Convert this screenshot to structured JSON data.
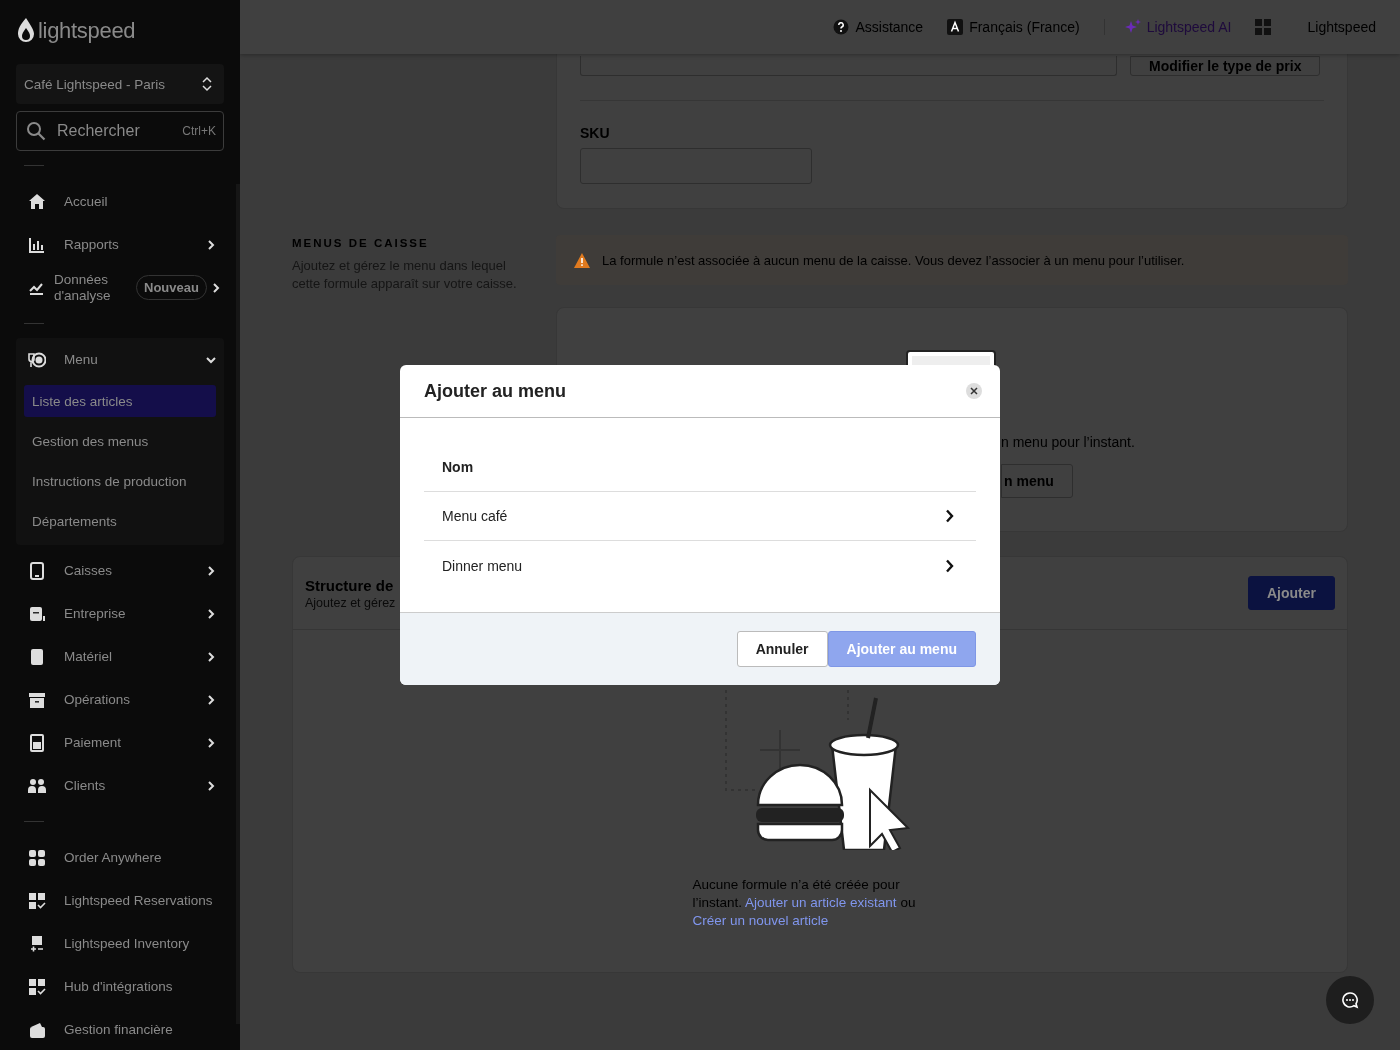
{
  "header": {
    "links": [
      {
        "kind": "help",
        "label": "Assistance"
      },
      {
        "kind": "language",
        "label": "Français (France)"
      },
      {
        "kind": "ai",
        "label": "Lightspeed AI"
      },
      {
        "kind": "apps"
      },
      {
        "kind": "account",
        "label": "Lightspeed"
      }
    ]
  },
  "sidebar": {
    "logo": "lightspeed",
    "store": "Café Lightspeed - Paris",
    "search": {
      "placeholder": "Rechercher",
      "shortcut": "Ctrl+K"
    },
    "groups": [
      {
        "items": [
          {
            "kind": "home",
            "label": "Accueil"
          },
          {
            "kind": "chart",
            "label": "Rapports",
            "expanded": false
          },
          {
            "kind": "trend",
            "label": "Données d'analyse",
            "badge": "Nouveau",
            "expanded": false
          }
        ]
      },
      {
        "items": [
          {
            "kind": "plate",
            "label": "Menu",
            "expanded": true,
            "children": [
              {
                "label": "Liste des articles",
                "selected": true
              },
              {
                "label": "Gestion des menus",
                "selected": false
              },
              {
                "label": "Instructions de production",
                "selected": false
              },
              {
                "label": "Départements",
                "selected": false
              }
            ]
          },
          {
            "kind": "tablet",
            "label": "Caisses",
            "expanded": false
          },
          {
            "kind": "business",
            "label": "Entreprise",
            "expanded": false
          },
          {
            "kind": "device",
            "label": "Matériel",
            "expanded": false
          },
          {
            "kind": "archive",
            "label": "Opérations",
            "expanded": false
          },
          {
            "kind": "calculator",
            "label": "Paiement",
            "expanded": false
          },
          {
            "kind": "people",
            "label": "Clients",
            "expanded": false
          }
        ]
      },
      {
        "items": [
          {
            "kind": "grid",
            "label": "Order Anywhere"
          },
          {
            "kind": "gridcheck",
            "label": "Lightspeed Reservations"
          },
          {
            "kind": "inventory",
            "label": "Lightspeed Inventory"
          },
          {
            "kind": "gridcheck",
            "label": "Hub d'intégrations"
          },
          {
            "kind": "wallet",
            "label": "Gestion financière"
          }
        ]
      }
    ]
  },
  "price_row": {
    "button": "Modifier le type de prix"
  },
  "sku": {
    "label": "SKU"
  },
  "pos_menus": {
    "title": "MENUS DE CAISSE",
    "description": "Ajoutez et gérez le menu dans lequel cette formule apparaît sur votre caisse.",
    "warning": "La formule n’est associée à aucun menu de la caisse. Vous devez l’associer à un menu pour l’utiliser.",
    "empty_text": "n menu pour l’instant.",
    "button": "n menu"
  },
  "structure": {
    "title": "Structure de",
    "description": "Ajoutez et gérez",
    "button": "Ajouter",
    "empty_text": "Aucune formule n’a été créée pour l’instant.",
    "link_1": "Ajouter un article existant",
    "joiner": "ou",
    "link_2": "Créer un nouvel article"
  },
  "modal": {
    "title": "Ajouter au menu",
    "column": "Nom",
    "rows": [
      "Menu café",
      "Dinner menu"
    ],
    "buttons": [
      {
        "label": "Annuler",
        "kind": "secondary",
        "disabled": false
      },
      {
        "label": "Ajouter au menu",
        "kind": "primary",
        "disabled": true
      }
    ]
  }
}
